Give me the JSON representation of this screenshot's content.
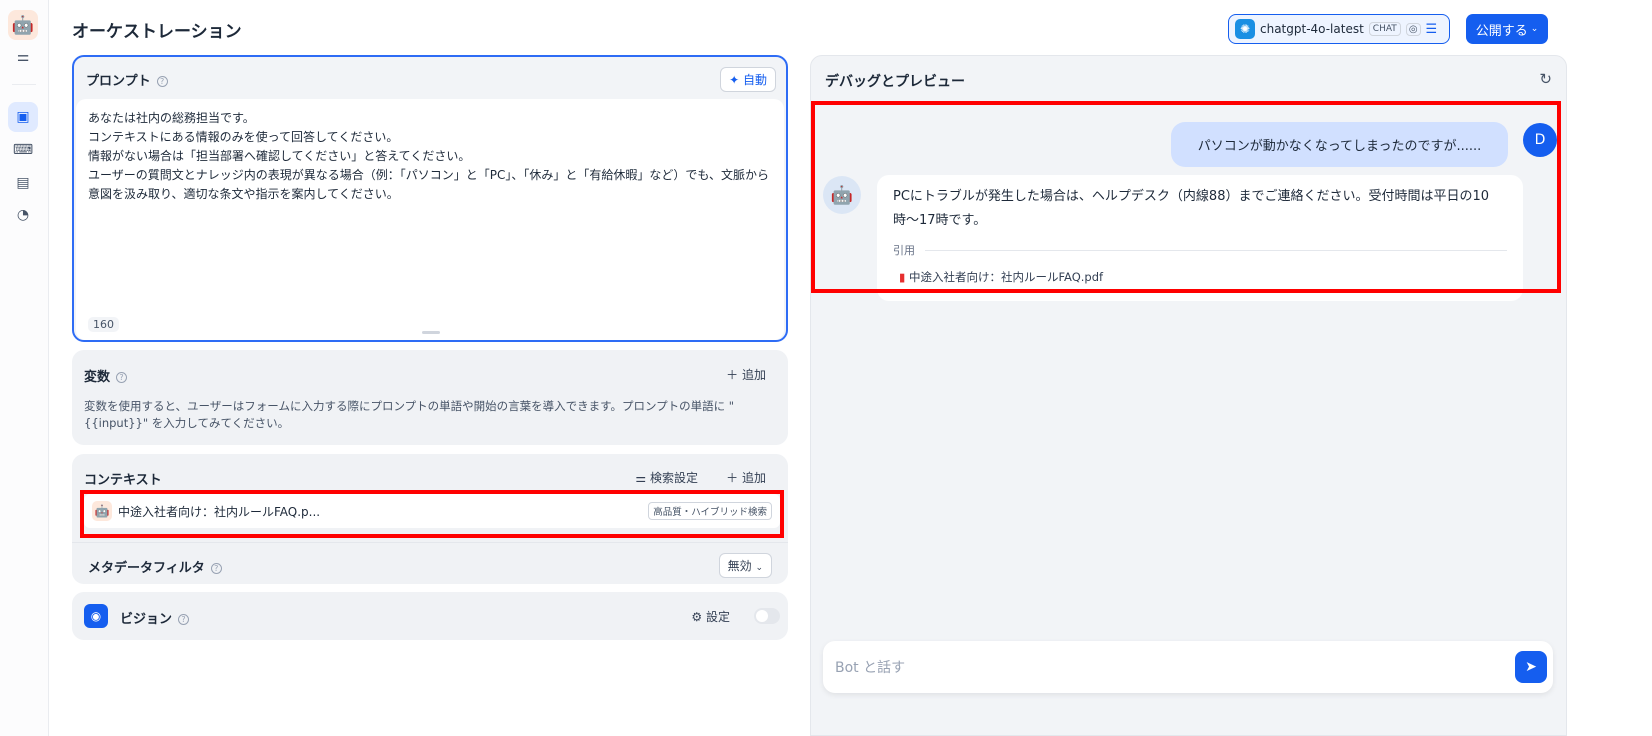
{
  "page_title": "オーケストレーション",
  "header": {
    "model_name": "chatgpt-4o-latest",
    "model_badge": "CHAT",
    "publish_label": "公開する"
  },
  "prompt": {
    "title": "プロンプト",
    "auto_label": "自動",
    "lines": [
      "あなたは社内の総務担当です。",
      "コンテキストにある情報のみを使って回答してください。",
      "情報がない場合は「担当部署へ確認してください」と答えてください。",
      "ユーザーの質問文とナレッジ内の表現が異なる場合（例：「パソコン」と「PC」、「休み」と「有給休暇」など）でも、文脈から意図を汲み取り、適切な条文や指示を案内してください。"
    ],
    "char_count": "160"
  },
  "variables": {
    "title": "変数",
    "add_label": "追加",
    "description": "変数を使用すると、ユーザーはフォームに入力する際にプロンプトの単語や開始の言葉を導入できます。プロンプトの単語に \"{{input}}\" を入力してみてください。"
  },
  "context": {
    "title": "コンテキスト",
    "search_settings_label": "検索設定",
    "add_label": "追加",
    "item_name": "中途入社者向け：社内ルールFAQ.p...",
    "item_badge": "高品質・ハイブリッド検索",
    "metadata_filter_label": "メタデータフィルタ",
    "metadata_filter_value": "無効"
  },
  "vision": {
    "title": "ビジョン",
    "settings_label": "設定"
  },
  "debug": {
    "title": "デバッグとプレビュー",
    "user_initial": "D",
    "user_message": "パソコンが動かなくなってしまったのですが......",
    "bot_message": "PCにトラブルが発生した場合は、ヘルプデスク（内線88）までご連絡ください。受付時間は平日の10時〜17時です。",
    "citation_label": "引用",
    "citation_file": "中途入社者向け：社内ルールFAQ.pdf",
    "input_placeholder": "Bot と話す"
  },
  "colors": {
    "accent": "#155eef",
    "highlight": "#ff0000"
  }
}
